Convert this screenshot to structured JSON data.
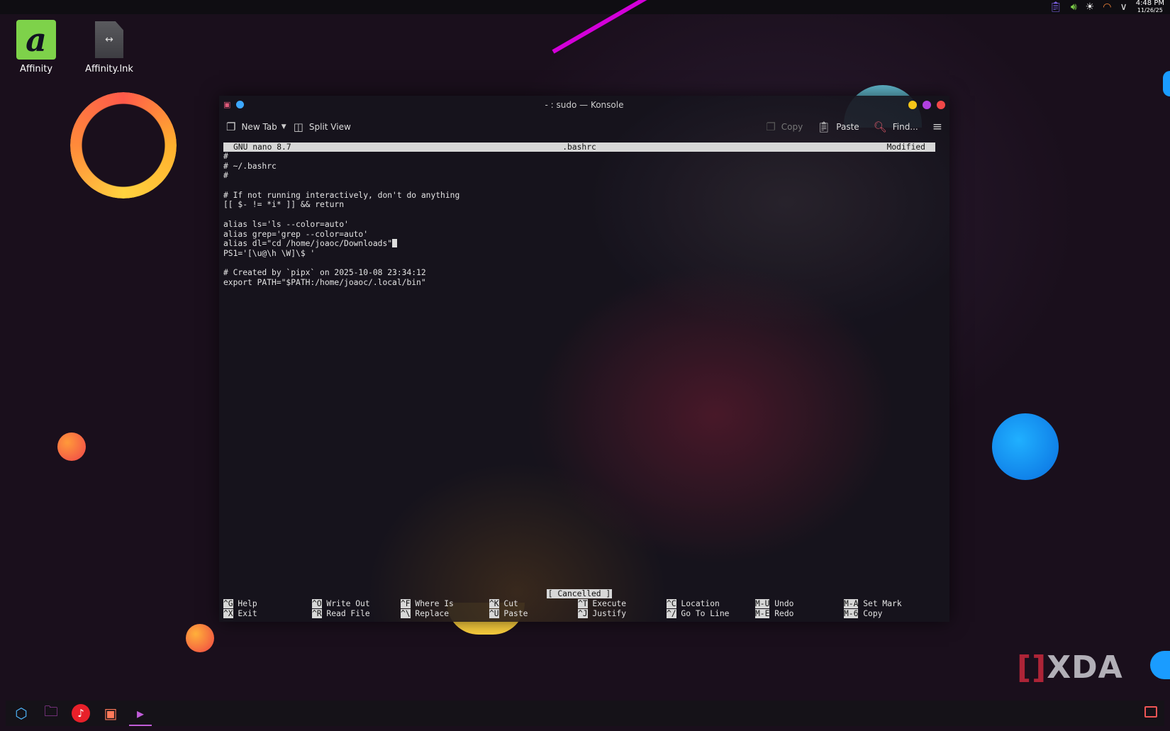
{
  "top_panel": {
    "clock_time": "4:48 PM",
    "clock_date": "11/26/25",
    "tray_icons": [
      "clipboard-icon",
      "volume-icon",
      "brightness-icon",
      "wifi-icon",
      "chevron-down-icon"
    ]
  },
  "desktop": {
    "icons": [
      {
        "label": "Affinity",
        "icon": "affinity-app-icon"
      },
      {
        "label": "Affinity.lnk",
        "icon": "shortcut-file-icon"
      }
    ],
    "watermark": "XDA",
    "watermark_bracket": "[",
    "watermark_bracket_close": "]"
  },
  "window": {
    "title": "- : sudo — Konsole",
    "toolbar": {
      "new_tab": "New Tab",
      "split_view": "Split View",
      "copy": "Copy",
      "paste": "Paste",
      "find": "Find..."
    }
  },
  "nano": {
    "header": {
      "app": "GNU nano 8.7",
      "file": ".bashrc",
      "state": "Modified"
    },
    "lines": [
      "#",
      "# ~/.bashrc",
      "#",
      "",
      "# If not running interactively, don't do anything",
      "[[ $- != *i* ]] && return",
      "",
      "alias ls='ls --color=auto'",
      "alias grep='grep --color=auto'",
      "alias dl=\"cd /home/joaoc/Downloads\"",
      "PS1='[\\u@\\h \\W]\\$ '",
      "",
      "# Created by `pipx` on 2025-10-08 23:34:12",
      "export PATH=\"$PATH:/home/joaoc/.local/bin\""
    ],
    "status": "[ Cancelled ]",
    "shortcuts_row1": [
      {
        "key": "^G",
        "label": "Help"
      },
      {
        "key": "^O",
        "label": "Write Out"
      },
      {
        "key": "^F",
        "label": "Where Is"
      },
      {
        "key": "^K",
        "label": "Cut"
      },
      {
        "key": "^T",
        "label": "Execute"
      },
      {
        "key": "^C",
        "label": "Location"
      },
      {
        "key": "M-U",
        "label": "Undo"
      },
      {
        "key": "M-A",
        "label": "Set Mark"
      }
    ],
    "shortcuts_row2": [
      {
        "key": "^X",
        "label": "Exit"
      },
      {
        "key": "^R",
        "label": "Read File"
      },
      {
        "key": "^\\",
        "label": "Replace"
      },
      {
        "key": "^U",
        "label": "Paste"
      },
      {
        "key": "^J",
        "label": "Justify"
      },
      {
        "key": "^/",
        "label": "Go To Line"
      },
      {
        "key": "M-E",
        "label": "Redo"
      },
      {
        "key": "M-6",
        "label": "Copy"
      }
    ]
  },
  "taskbar": {
    "items": [
      "app-launcher-icon",
      "file-manager-icon",
      "music-player-icon",
      "remote-desktop-icon",
      "konsole-icon"
    ],
    "active": "konsole-icon"
  },
  "colors": {
    "affinity_green": "#7ed24a",
    "accent_magenta": "#d300d9",
    "close_red": "#f04848",
    "minimize_yellow": "#f5c518",
    "maximize_purple": "#b040e0",
    "bubble_blue": "#1a9cff"
  }
}
